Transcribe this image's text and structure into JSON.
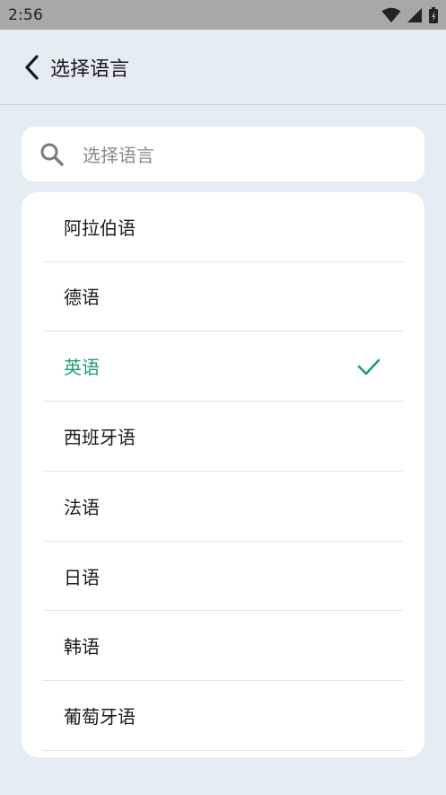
{
  "status_bar": {
    "time": "2:56"
  },
  "header": {
    "title": "选择语言"
  },
  "search": {
    "placeholder": "选择语言"
  },
  "languages": [
    {
      "label": "阿拉伯语",
      "selected": false
    },
    {
      "label": "德语",
      "selected": false
    },
    {
      "label": "英语",
      "selected": true
    },
    {
      "label": "西班牙语",
      "selected": false
    },
    {
      "label": "法语",
      "selected": false
    },
    {
      "label": "日语",
      "selected": false
    },
    {
      "label": "韩语",
      "selected": false
    },
    {
      "label": "葡萄牙语",
      "selected": false
    }
  ],
  "colors": {
    "accent": "#1f9c72",
    "background": "#e6ecf4",
    "status_bar": "#a8a8a8"
  },
  "icons": {
    "back": "chevron-left-icon",
    "search": "search-icon",
    "check": "check-icon"
  }
}
